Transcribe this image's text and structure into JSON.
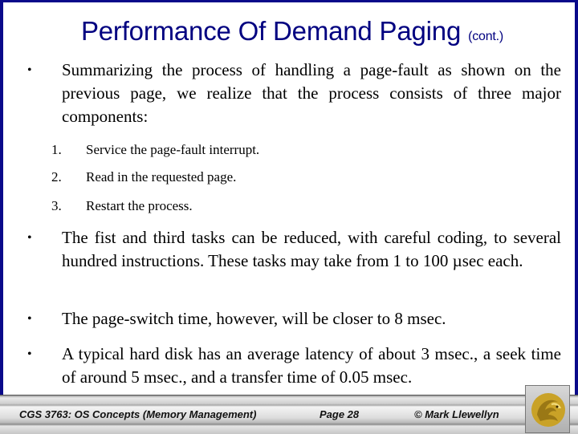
{
  "slide": {
    "title": "Performance Of Demand Paging",
    "title_suffix": "(cont.)",
    "bullets": [
      {
        "marker": "•",
        "text": "Summarizing the process of handling a page-fault as shown on the previous page, we realize that the process consists of three major components:",
        "subitems": [
          {
            "num": "1.",
            "text": "Service the page-fault interrupt."
          },
          {
            "num": "2.",
            "text": "Read in the requested page."
          },
          {
            "num": "3.",
            "text": "Restart the process."
          }
        ]
      },
      {
        "marker": "•",
        "text": "The fist and third tasks can be reduced, with careful coding, to several hundred instructions.  These tasks may take from 1 to 100 µsec each."
      },
      {
        "marker": "•",
        "text": "The page-switch time, however, will be closer to 8 msec."
      },
      {
        "marker": "•",
        "text": "A typical hard disk has an average latency of about 3 msec., a seek time of around 5 msec., and a transfer time of 0.05 msec."
      }
    ]
  },
  "footer": {
    "course": "CGS 3763: OS Concepts  (Memory Management)",
    "page": "Page 28",
    "author": "© Mark Llewellyn",
    "logo_icon": "ucf-pegasus-logo"
  },
  "colors": {
    "title": "#000080",
    "border": "#0a0a8a",
    "logo_gold": "#c9a227"
  }
}
